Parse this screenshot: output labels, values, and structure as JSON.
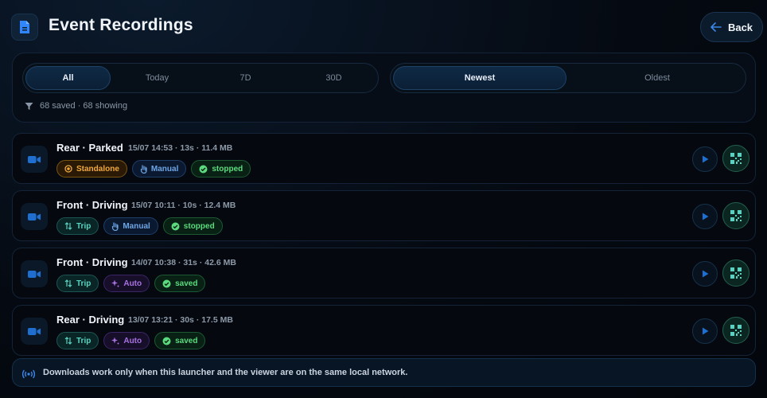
{
  "header": {
    "title": "Event Recordings",
    "app_icon": "document-icon",
    "back_label": "Back"
  },
  "filters": {
    "time_tabs": [
      {
        "label": "All",
        "active": true
      },
      {
        "label": "Today",
        "active": false
      },
      {
        "label": "7D",
        "active": false
      },
      {
        "label": "30D",
        "active": false
      }
    ],
    "sort_tabs": [
      {
        "label": "Newest",
        "active": true
      },
      {
        "label": "Oldest",
        "active": false
      }
    ],
    "status_text": "68 saved · 68 showing"
  },
  "recordings": [
    {
      "title": "Rear · Parked",
      "meta": "15/07 14:53 · 13s · 11.4 MB",
      "badges": [
        {
          "label": "Standalone",
          "kind": "standalone",
          "icon": "record-icon"
        },
        {
          "label": "Manual",
          "kind": "manual",
          "icon": "hand-icon"
        },
        {
          "label": "stopped",
          "kind": "status",
          "icon": "check-circle-icon"
        }
      ]
    },
    {
      "title": "Front · Driving",
      "meta": "15/07 10:11 · 10s · 12.4 MB",
      "badges": [
        {
          "label": "Trip",
          "kind": "trip",
          "icon": "swap-icon"
        },
        {
          "label": "Manual",
          "kind": "manual",
          "icon": "hand-icon"
        },
        {
          "label": "stopped",
          "kind": "status",
          "icon": "check-circle-icon"
        }
      ]
    },
    {
      "title": "Front · Driving",
      "meta": "14/07 10:38 · 31s · 42.6 MB",
      "badges": [
        {
          "label": "Trip",
          "kind": "trip",
          "icon": "swap-icon"
        },
        {
          "label": "Auto",
          "kind": "auto",
          "icon": "sparkle-icon"
        },
        {
          "label": "saved",
          "kind": "status",
          "icon": "check-circle-icon"
        }
      ]
    },
    {
      "title": "Rear · Driving",
      "meta": "13/07 13:21 · 30s · 17.5 MB",
      "badges": [
        {
          "label": "Trip",
          "kind": "trip",
          "icon": "swap-icon"
        },
        {
          "label": "Auto",
          "kind": "auto",
          "icon": "sparkle-icon"
        },
        {
          "label": "saved",
          "kind": "status",
          "icon": "check-circle-icon"
        }
      ]
    }
  ],
  "notice": {
    "text": "Downloads work only when this launcher and the viewer are on the same local network.",
    "icon": "wifi-signal-icon"
  },
  "colors": {
    "accent": "#1f6fd1",
    "trip": "#58d3c1",
    "standalone": "#f1a93a",
    "manual": "#6ea6e6",
    "auto": "#a873e0",
    "status": "#5bdb7e"
  }
}
